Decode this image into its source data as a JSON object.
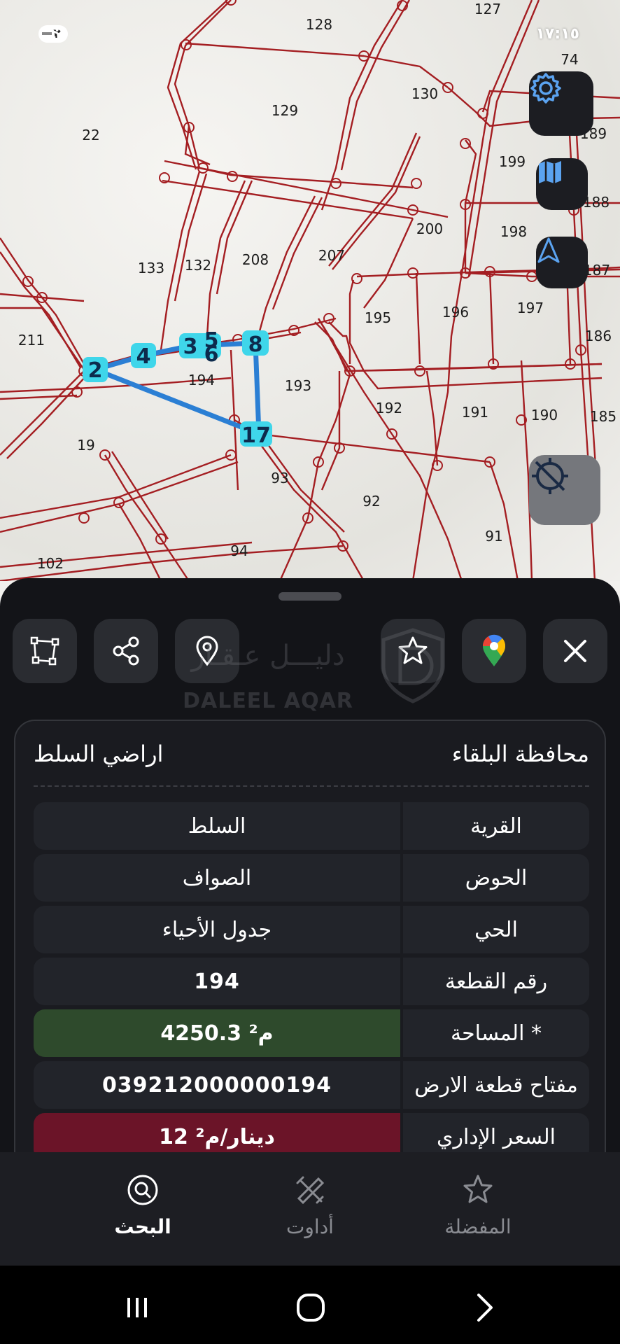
{
  "status_bar": {
    "time": "١٧:١٥",
    "battery": "٧٢"
  },
  "map": {
    "parcel_labels": [
      "128",
      "127",
      "74",
      "130",
      "129",
      "22",
      "189",
      "199",
      "188",
      "200",
      "198",
      "187",
      "133",
      "132",
      "208",
      "207",
      "211",
      "195",
      "196",
      "197",
      "186",
      "194",
      "193",
      "192",
      "191",
      "190",
      "185",
      "19",
      "93",
      "92",
      "91",
      "102",
      "94"
    ],
    "vertex_labels": [
      "2",
      "4",
      "3",
      "5",
      "6",
      "8",
      "17"
    ],
    "buttons": {
      "settings_icon": "gear-icon",
      "layers_icon": "map-icon",
      "north_icon": "north-arrow-icon",
      "location_icon": "location-off-icon"
    },
    "colors": {
      "boundary": "#a41e22",
      "selection": "#2b7fd4",
      "vertex": "#3fd6ea"
    }
  },
  "sheet": {
    "actions": [
      {
        "icon": "polygon-icon"
      },
      {
        "icon": "share-icon"
      },
      {
        "icon": "location-pin-icon"
      },
      {
        "icon": "star-icon"
      },
      {
        "icon": "google-maps-icon"
      },
      {
        "icon": "close-icon"
      }
    ],
    "watermark": {
      "arabic": "دليـــل عـقـار",
      "english": "DALEEL AQAR"
    },
    "header": {
      "title_right": "محافظة البلقاء",
      "title_left": "اراضي السلط"
    },
    "rows": [
      {
        "key": "القرية",
        "value": "السلط"
      },
      {
        "key": "الحوض",
        "value": "الصواف"
      },
      {
        "key": "الحي",
        "value": "جدول الأحياء"
      },
      {
        "key": "رقم القطعة",
        "value": "194"
      },
      {
        "key": "المساحة *",
        "value": "4250.3 م²"
      },
      {
        "key": "مفتاح قطعة الارض",
        "value": "039212000000194"
      },
      {
        "key": "السعر الإداري",
        "value": "12 دينار/م²"
      }
    ],
    "colors": {
      "area_bg": "#2e4a2c",
      "price_bg": "#6b1428"
    }
  },
  "bottom_nav": {
    "items": [
      {
        "label": "البحث",
        "icon": "search-icon",
        "active": true
      },
      {
        "label": "أداوت",
        "icon": "tools-icon",
        "active": false
      },
      {
        "label": "المفضلة",
        "icon": "star-icon",
        "active": false
      }
    ]
  },
  "system_nav": {
    "icons": [
      "recents-icon",
      "home-icon",
      "back-icon"
    ]
  }
}
